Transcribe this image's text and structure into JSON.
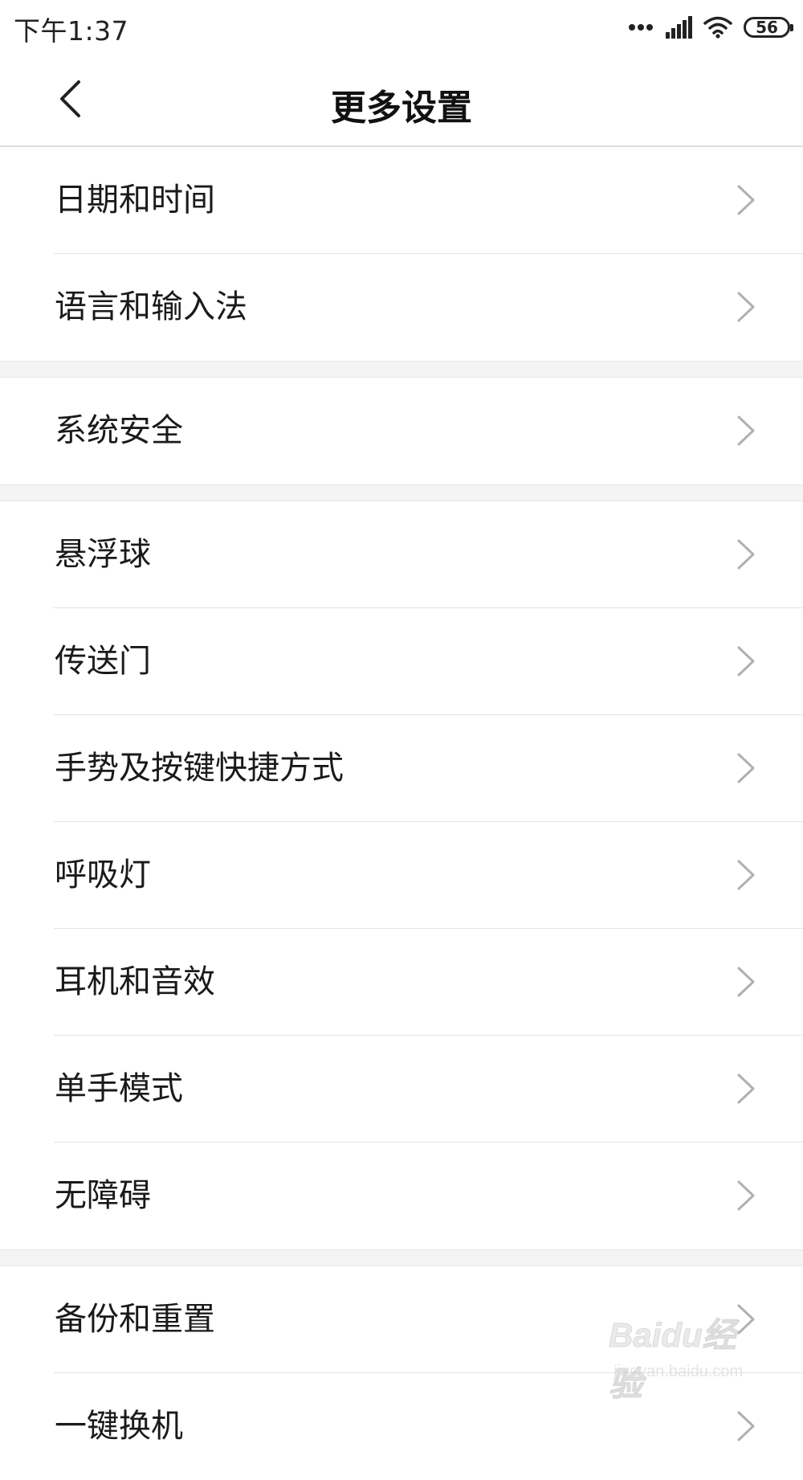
{
  "status_bar": {
    "time": "下午1:37",
    "battery_level": "56",
    "icons": [
      "more-dots-icon",
      "cellular-signal-icon",
      "wifi-icon",
      "battery-icon"
    ]
  },
  "header": {
    "title": "更多设置",
    "back_icon": "chevron-left-icon"
  },
  "groups": [
    {
      "items": [
        {
          "label": "日期和时间",
          "icon": "chevron-right-icon"
        },
        {
          "label": "语言和输入法",
          "icon": "chevron-right-icon"
        }
      ]
    },
    {
      "items": [
        {
          "label": "系统安全",
          "icon": "chevron-right-icon"
        }
      ]
    },
    {
      "items": [
        {
          "label": "悬浮球",
          "icon": "chevron-right-icon"
        },
        {
          "label": "传送门",
          "icon": "chevron-right-icon"
        },
        {
          "label": "手势及按键快捷方式",
          "icon": "chevron-right-icon"
        },
        {
          "label": "呼吸灯",
          "icon": "chevron-right-icon"
        },
        {
          "label": "耳机和音效",
          "icon": "chevron-right-icon"
        },
        {
          "label": "单手模式",
          "icon": "chevron-right-icon"
        },
        {
          "label": "无障碍",
          "icon": "chevron-right-icon"
        }
      ]
    },
    {
      "items": [
        {
          "label": "备份和重置",
          "icon": "chevron-right-icon"
        },
        {
          "label": "一键换机",
          "icon": "chevron-right-icon"
        }
      ]
    }
  ],
  "watermark": {
    "logo_text": "Baidu经验",
    "sub_text": "jingyan.baidu.com"
  },
  "colors": {
    "background": "#ffffff",
    "group_gap": "#f4f4f4",
    "divider": "#e3e3e3",
    "chevron": "#b0b0b0",
    "text": "#1a1a1a"
  }
}
